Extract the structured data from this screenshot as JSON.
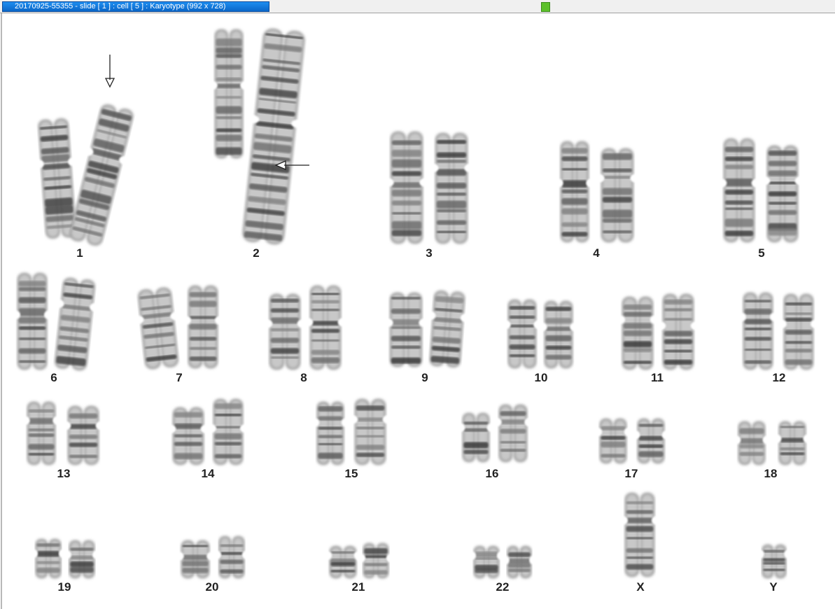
{
  "window": {
    "title": "20170925-55355 - slide [ 1 ] : cell [ 5 ] : Karyotype  (992 x 728)",
    "status_color": "#5cc02a"
  },
  "karyotype": {
    "chromosome_labels": [
      "1",
      "2",
      "3",
      "4",
      "5",
      "6",
      "7",
      "8",
      "9",
      "10",
      "11",
      "12",
      "13",
      "14",
      "15",
      "16",
      "17",
      "18",
      "19",
      "20",
      "21",
      "22",
      "X",
      "Y"
    ],
    "arrow_markers": [
      {
        "chromosome": "1",
        "direction": "down"
      },
      {
        "chromosome": "2",
        "direction": "left"
      }
    ]
  }
}
